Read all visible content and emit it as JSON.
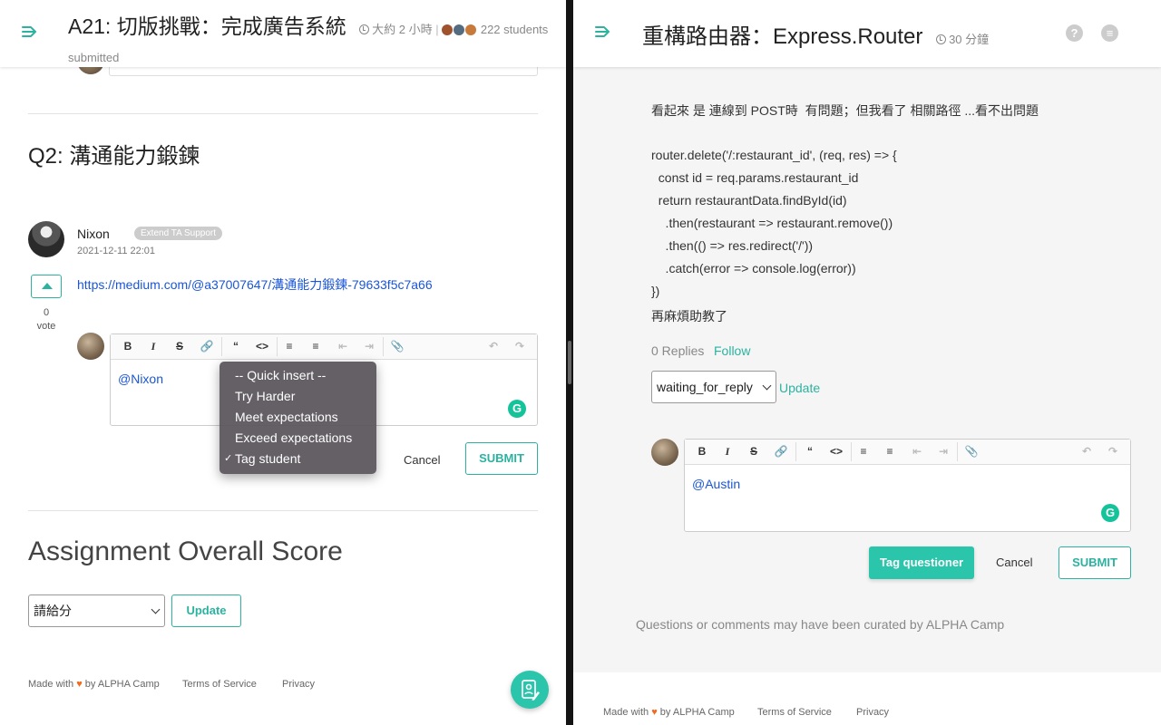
{
  "left": {
    "title": "A21: 切版挑戰：完成廣告系統",
    "duration": "大約 2 小時",
    "students": "222 students",
    "submitted": "submitted",
    "section_title": "Q2: 溝通能力鍛鍊",
    "comment": {
      "author": "Nixon",
      "badge": "Extend TA Support",
      "timestamp": "2021-12-11 22:01",
      "link": "https://medium.com/@a37007647/溝通能力鍛鍊-79633f5c7a66",
      "vote_count": "0",
      "vote_label": "vote"
    },
    "editor_text": "@Nixon",
    "quick_insert": {
      "items": [
        "-- Quick insert --",
        "Try Harder",
        "Meet expectations",
        "Exceed expectations",
        "Tag student"
      ],
      "checked": "Tag student"
    },
    "cancel_label": "Cancel",
    "submit_label": "SUBMIT",
    "score_title": "Assignment Overall Score",
    "score_select": "請給分",
    "update_label": "Update",
    "footer": {
      "made_with_pre": "Made with",
      "heart": "♥",
      "made_with_post": "by ALPHA Camp",
      "terms": "Terms of Service",
      "privacy": "Privacy"
    }
  },
  "right": {
    "title": "重構路由器：Express.Router",
    "duration": "30 分鐘",
    "body_lines": [
      "看起來 是 連線到 POST時  有問題；但我看了 相關路徑 ...看不出問題",
      "router.delete('/:restaurant_id', (req, res) => {",
      "  const id = req.params.restaurant_id",
      "  return restaurantData.findById(id)",
      "    .then(restaurant => restaurant.remove())",
      "    .then(() => res.redirect('/'))",
      "    .catch(error => console.log(error))",
      "})",
      "再麻煩助教了"
    ],
    "replies": "0 Replies",
    "follow": "Follow",
    "status_select": "waiting_for_reply",
    "update_label": "Update",
    "editor_text": "@Austin",
    "tag_label": "Tag questioner",
    "cancel_label": "Cancel",
    "submit_label": "SUBMIT",
    "curated": "Questions or comments may have been curated by ALPHA Camp",
    "footer": {
      "made_with_pre": "Made with",
      "heart": "♥",
      "made_with_post": "by ALPHA Camp",
      "terms": "Terms of Service",
      "privacy": "Privacy"
    }
  },
  "colors": {
    "accent": "#2bb3a0",
    "accent_fill": "#2bc5ac",
    "link": "#1a56d6",
    "heart": "#f26a1b"
  },
  "icons": [
    "menu-icon",
    "clock-icon",
    "help-icon",
    "chat-icon",
    "grammarly-icon",
    "fab-edit-icon"
  ]
}
